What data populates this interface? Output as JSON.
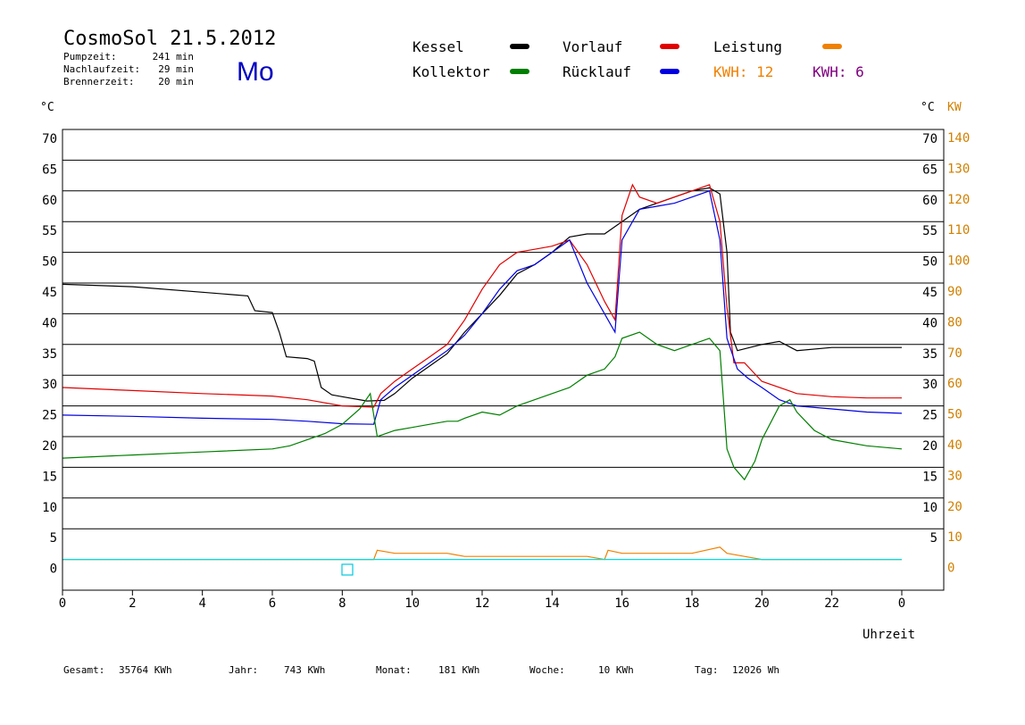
{
  "header": {
    "title": "CosmoSol 21.5.2012",
    "day": "Mo",
    "stats": [
      {
        "label": "Pumpzeit:",
        "value": "241 min"
      },
      {
        "label": "Nachlaufzeit:",
        "value": "29 min"
      },
      {
        "label": "Brennerzeit:",
        "value": "20 min"
      }
    ]
  },
  "legend": {
    "kessel": "Kessel",
    "kollektor": "Kollektor",
    "vorlauf": "Vorlauf",
    "ruecklauf": "Rücklauf",
    "leistung": "Leistung",
    "kwh1": "KWH: 12",
    "kwh2": "KWH: 6"
  },
  "axes": {
    "left_unit": "°C",
    "right_unit_c": "°C",
    "right_unit_kw": "KW",
    "x_label": "Uhrzeit"
  },
  "footer": [
    {
      "label": "Gesamt:",
      "value": "35764 KWh"
    },
    {
      "label": "Jahr:",
      "value": "743 KWh"
    },
    {
      "label": "Monat:",
      "value": "181 KWh"
    },
    {
      "label": "Woche:",
      "value": "10 KWh"
    },
    {
      "label": "Tag:",
      "value": "12026 Wh"
    }
  ],
  "colors": {
    "kessel": "#000000",
    "kollektor": "#007f00",
    "vorlauf": "#e00000",
    "ruecklauf": "#0000e0",
    "leistung": "#f08000",
    "kwh2": "#800080",
    "zero_line": "#00e0e0",
    "kw_axis": "#d08000",
    "day": "#0000c0"
  },
  "chart_data": {
    "type": "line",
    "xlabel": "Uhrzeit",
    "ylabel": "°C",
    "xlim": [
      0,
      24
    ],
    "ylim": [
      -5,
      70
    ],
    "y2lim": [
      -10,
      140
    ],
    "x_ticks": [
      "0",
      "2",
      "4",
      "6",
      "8",
      "10",
      "12",
      "14",
      "16",
      "18",
      "20",
      "22",
      "0"
    ],
    "y_ticks": [
      0,
      5,
      10,
      15,
      20,
      25,
      30,
      35,
      40,
      45,
      50,
      55,
      60,
      65,
      70
    ],
    "y_ticks_right_c": [
      5,
      10,
      15,
      20,
      25,
      30,
      35,
      40,
      45,
      50,
      55,
      60,
      65,
      70
    ],
    "y_ticks_right_kw": [
      0,
      10,
      20,
      30,
      40,
      50,
      60,
      70,
      80,
      90,
      100,
      110,
      120,
      130,
      140
    ],
    "grid": "horizontal",
    "series": [
      {
        "name": "Kessel",
        "color": "#000000",
        "points": [
          [
            0,
            44.8
          ],
          [
            2,
            44.4
          ],
          [
            4,
            43.5
          ],
          [
            5.3,
            42.9
          ],
          [
            5.5,
            40.5
          ],
          [
            6,
            40.2
          ],
          [
            6.2,
            37
          ],
          [
            6.4,
            33
          ],
          [
            7,
            32.7
          ],
          [
            7.2,
            32.3
          ],
          [
            7.4,
            28
          ],
          [
            7.7,
            26.8
          ],
          [
            8,
            26.5
          ],
          [
            8.7,
            25.8
          ],
          [
            9.2,
            25.9
          ],
          [
            9.5,
            27
          ],
          [
            10,
            29.5
          ],
          [
            10.5,
            31.5
          ],
          [
            11,
            33.5
          ],
          [
            11.5,
            37
          ],
          [
            12,
            40
          ],
          [
            12.5,
            43
          ],
          [
            13,
            46.5
          ],
          [
            13.5,
            48
          ],
          [
            14,
            50
          ],
          [
            14.5,
            52.5
          ],
          [
            15,
            53
          ],
          [
            15.5,
            53
          ],
          [
            16,
            55
          ],
          [
            16.5,
            57
          ],
          [
            17,
            58
          ],
          [
            17.5,
            59
          ],
          [
            18,
            60
          ],
          [
            18.5,
            60.5
          ],
          [
            18.8,
            59.5
          ],
          [
            19,
            50
          ],
          [
            19.1,
            37
          ],
          [
            19.3,
            34
          ],
          [
            20,
            35
          ],
          [
            20.5,
            35.5
          ],
          [
            21,
            34
          ],
          [
            22,
            34.5
          ],
          [
            23,
            34.5
          ],
          [
            24,
            34.5
          ]
        ]
      },
      {
        "name": "Vorlauf",
        "color": "#e00000",
        "points": [
          [
            0,
            28
          ],
          [
            2,
            27.5
          ],
          [
            4,
            27
          ],
          [
            6,
            26.6
          ],
          [
            7,
            26
          ],
          [
            8,
            25
          ],
          [
            8.9,
            24.8
          ],
          [
            9.1,
            27
          ],
          [
            9.5,
            29
          ],
          [
            10,
            31
          ],
          [
            10.5,
            33
          ],
          [
            11,
            35
          ],
          [
            11.5,
            39
          ],
          [
            12,
            44
          ],
          [
            12.5,
            48
          ],
          [
            13,
            50
          ],
          [
            13.5,
            50.5
          ],
          [
            14,
            51
          ],
          [
            14.5,
            52
          ],
          [
            15,
            48
          ],
          [
            15.5,
            42
          ],
          [
            15.8,
            39
          ],
          [
            16,
            56
          ],
          [
            16.3,
            61
          ],
          [
            16.5,
            59
          ],
          [
            17,
            58
          ],
          [
            17.5,
            59
          ],
          [
            18,
            60
          ],
          [
            18.5,
            61
          ],
          [
            18.8,
            55
          ],
          [
            19,
            41
          ],
          [
            19.2,
            32
          ],
          [
            19.5,
            32
          ],
          [
            20,
            29
          ],
          [
            21,
            27
          ],
          [
            22,
            26.5
          ],
          [
            23,
            26.3
          ],
          [
            24,
            26.3
          ]
        ]
      },
      {
        "name": "Rücklauf",
        "color": "#0000e0",
        "points": [
          [
            0,
            23.5
          ],
          [
            2,
            23.3
          ],
          [
            4,
            23
          ],
          [
            6,
            22.8
          ],
          [
            7,
            22.5
          ],
          [
            8,
            22.1
          ],
          [
            8.9,
            22
          ],
          [
            9.1,
            26
          ],
          [
            9.5,
            28
          ],
          [
            10,
            30
          ],
          [
            10.5,
            32
          ],
          [
            11,
            34
          ],
          [
            11.5,
            36.5
          ],
          [
            12,
            40
          ],
          [
            12.5,
            44
          ],
          [
            13,
            47
          ],
          [
            13.5,
            48
          ],
          [
            14,
            50
          ],
          [
            14.5,
            52
          ],
          [
            15,
            45
          ],
          [
            15.5,
            40
          ],
          [
            15.8,
            37
          ],
          [
            16,
            52
          ],
          [
            16.5,
            57
          ],
          [
            17,
            57.5
          ],
          [
            17.5,
            58
          ],
          [
            18,
            59
          ],
          [
            18.5,
            60
          ],
          [
            18.8,
            52
          ],
          [
            19,
            36
          ],
          [
            19.3,
            31
          ],
          [
            19.6,
            29.5
          ],
          [
            20,
            28
          ],
          [
            20.5,
            26
          ],
          [
            21,
            25
          ],
          [
            22,
            24.5
          ],
          [
            23,
            24
          ],
          [
            24,
            23.8
          ]
        ]
      },
      {
        "name": "Kollektor",
        "color": "#007f00",
        "points": [
          [
            0,
            16.5
          ],
          [
            2,
            17
          ],
          [
            4,
            17.5
          ],
          [
            6,
            18
          ],
          [
            6.5,
            18.5
          ],
          [
            7,
            19.5
          ],
          [
            7.5,
            20.5
          ],
          [
            8,
            22
          ],
          [
            8.5,
            24.5
          ],
          [
            8.8,
            27
          ],
          [
            9,
            20
          ],
          [
            9.5,
            21
          ],
          [
            10,
            21.5
          ],
          [
            10.5,
            22
          ],
          [
            11,
            22.5
          ],
          [
            11.3,
            22.5
          ],
          [
            11.5,
            23
          ],
          [
            12,
            24
          ],
          [
            12.5,
            23.5
          ],
          [
            13,
            25
          ],
          [
            13.5,
            26
          ],
          [
            14,
            27
          ],
          [
            14.5,
            28
          ],
          [
            15,
            30
          ],
          [
            15.5,
            31
          ],
          [
            15.8,
            33
          ],
          [
            16,
            36
          ],
          [
            16.5,
            37
          ],
          [
            17,
            35
          ],
          [
            17.5,
            34
          ],
          [
            18,
            35
          ],
          [
            18.5,
            36
          ],
          [
            18.8,
            34
          ],
          [
            19,
            18
          ],
          [
            19.2,
            15
          ],
          [
            19.5,
            13
          ],
          [
            19.8,
            16
          ],
          [
            20,
            19.5
          ],
          [
            20.5,
            25
          ],
          [
            20.8,
            26
          ],
          [
            21,
            24
          ],
          [
            21.5,
            21
          ],
          [
            22,
            19.5
          ],
          [
            23,
            18.5
          ],
          [
            24,
            18
          ]
        ]
      },
      {
        "name": "Leistung",
        "color": "#f08000",
        "points": [
          [
            0,
            0
          ],
          [
            8.9,
            0
          ],
          [
            9,
            3
          ],
          [
            9.5,
            2
          ],
          [
            10,
            2
          ],
          [
            10.5,
            2
          ],
          [
            11,
            2
          ],
          [
            11.5,
            1
          ],
          [
            12,
            1
          ],
          [
            12.5,
            1
          ],
          [
            13,
            1
          ],
          [
            14,
            1
          ],
          [
            15,
            1
          ],
          [
            15.5,
            0
          ],
          [
            15.6,
            3
          ],
          [
            16,
            2
          ],
          [
            17,
            2
          ],
          [
            18,
            2
          ],
          [
            18.8,
            4
          ],
          [
            19,
            2
          ],
          [
            19.5,
            1
          ],
          [
            20,
            0
          ],
          [
            24,
            0
          ]
        ]
      }
    ]
  }
}
